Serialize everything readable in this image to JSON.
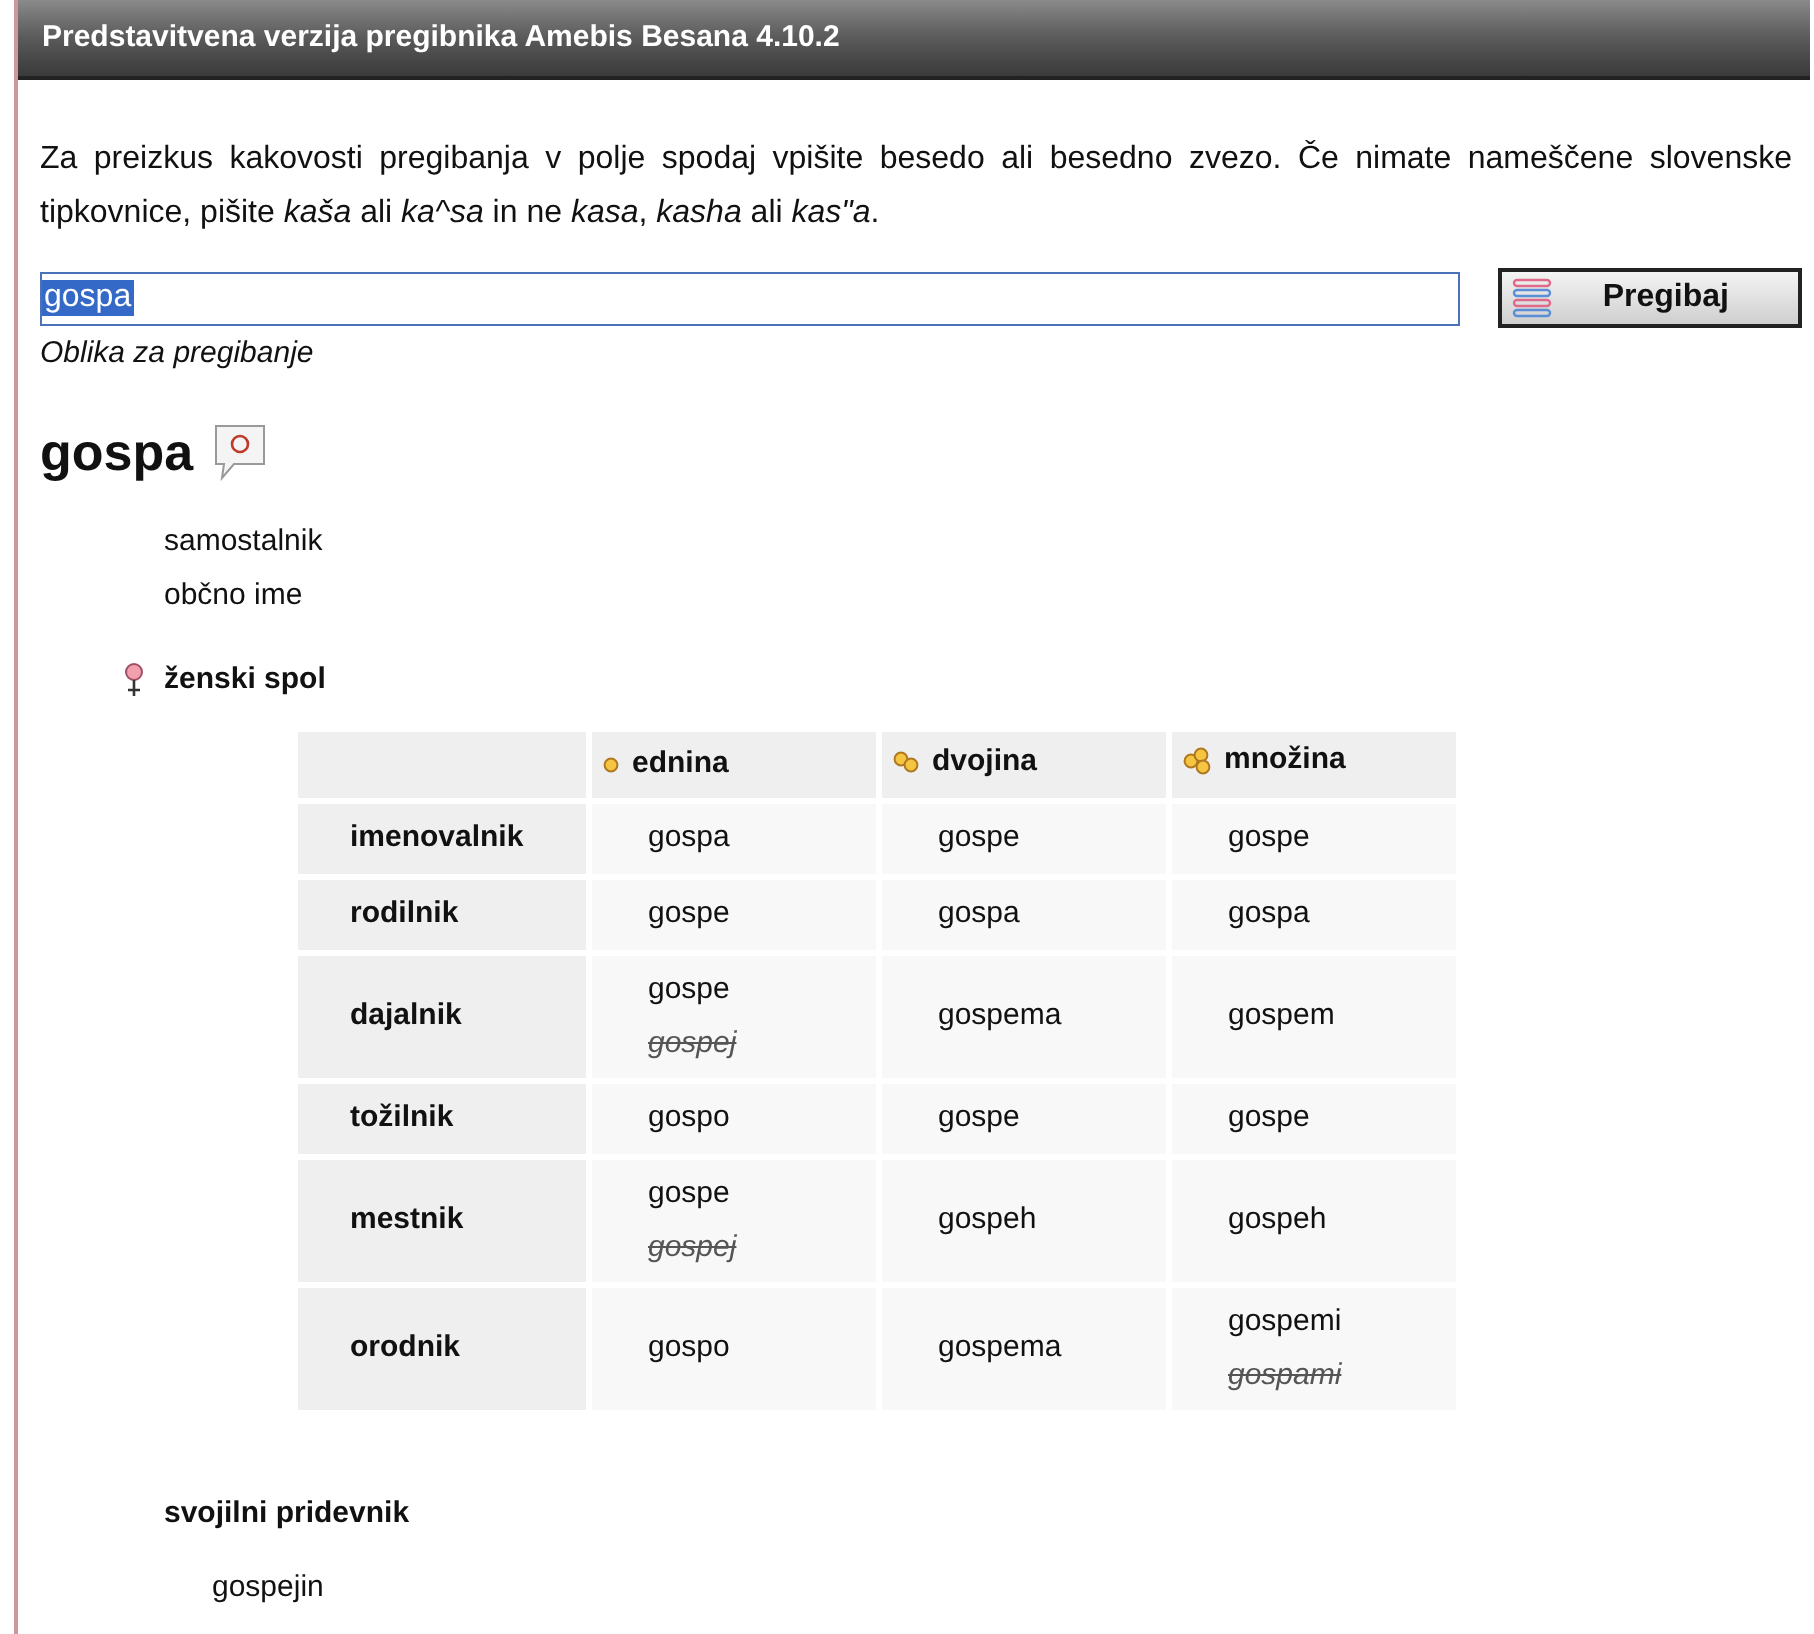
{
  "window": {
    "title": "Predstavitvena verzija pregibnika Amebis Besana 4.10.2"
  },
  "intro": "Za preizkus kakovosti pregibanja v polje spodaj vpišite besedo ali besedno zvezo. Če nimate nameščene slovenske tipkovnice, pišite *kaša* ali *ka^sa* in ne *kasa*, *kasha* ali *kas\"a*.",
  "search": {
    "value": "gospa",
    "selected": true,
    "hint": "Oblika za pregibanje",
    "button": "Pregibaj"
  },
  "headword": "gospa",
  "properties": [
    "samostalnik",
    "občno ime"
  ],
  "gender": "ženski spol",
  "table": {
    "columns": [
      {
        "label": "ednina"
      },
      {
        "label": "dvojina"
      },
      {
        "label": "množina"
      }
    ],
    "rows": [
      {
        "case": "imenovalnik",
        "cells": [
          [
            {
              "text": "gospa",
              "deprecated": false
            }
          ],
          [
            {
              "text": "gospe",
              "deprecated": false
            }
          ],
          [
            {
              "text": "gospe",
              "deprecated": false
            }
          ]
        ]
      },
      {
        "case": "rodilnik",
        "cells": [
          [
            {
              "text": "gospe",
              "deprecated": false
            }
          ],
          [
            {
              "text": "gospa",
              "deprecated": false
            }
          ],
          [
            {
              "text": "gospa",
              "deprecated": false
            }
          ]
        ]
      },
      {
        "case": "dajalnik",
        "cells": [
          [
            {
              "text": "gospe",
              "deprecated": false
            },
            {
              "text": "gospej",
              "deprecated": true
            }
          ],
          [
            {
              "text": "gospema",
              "deprecated": false
            }
          ],
          [
            {
              "text": "gospem",
              "deprecated": false
            }
          ]
        ]
      },
      {
        "case": "tožilnik",
        "cells": [
          [
            {
              "text": "gospo",
              "deprecated": false
            }
          ],
          [
            {
              "text": "gospe",
              "deprecated": false
            }
          ],
          [
            {
              "text": "gospe",
              "deprecated": false
            }
          ]
        ]
      },
      {
        "case": "mestnik",
        "cells": [
          [
            {
              "text": "gospe",
              "deprecated": false
            },
            {
              "text": "gospej",
              "deprecated": true
            }
          ],
          [
            {
              "text": "gospeh",
              "deprecated": false
            }
          ],
          [
            {
              "text": "gospeh",
              "deprecated": false
            }
          ]
        ]
      },
      {
        "case": "orodnik",
        "cells": [
          [
            {
              "text": "gospo",
              "deprecated": false
            }
          ],
          [
            {
              "text": "gospema",
              "deprecated": false
            }
          ],
          [
            {
              "text": "gospemi",
              "deprecated": false
            },
            {
              "text": "gospami",
              "deprecated": true
            }
          ]
        ]
      }
    ]
  },
  "derived": {
    "title": "svojilni pridevnik",
    "items": [
      "gospejin"
    ]
  }
}
